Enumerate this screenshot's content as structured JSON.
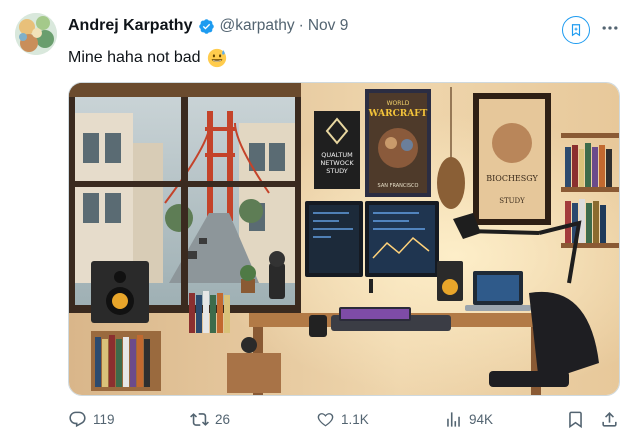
{
  "tweet": {
    "author_name": "Andrej Karpathy",
    "handle": "@karpathy",
    "separator": "·",
    "date": "Nov 9",
    "text": "Mine haha not bad",
    "emoji": "grinning-sweat-emoji"
  },
  "media": {
    "poster_left": "QUALTUM NETWOCK STUDY",
    "poster_center_title": "WORLD WARCRAFT",
    "poster_center_sub": "SAN FRANCISCO",
    "poster_right_title": "BIOCHESGY",
    "poster_right_sub": "STUDY"
  },
  "actions": {
    "replies": "119",
    "reposts": "26",
    "likes": "1.1K",
    "views": "94K"
  },
  "icons": {
    "verified": "verified-badge-icon",
    "grok": "grok-icon",
    "more": "more-icon",
    "reply": "reply-icon",
    "repost": "repost-icon",
    "like": "like-icon",
    "views": "views-icon",
    "bookmark": "bookmark-icon",
    "share": "share-icon"
  },
  "colors": {
    "accent": "#1d9bf0",
    "text": "#0f1419",
    "muted": "#536471"
  }
}
